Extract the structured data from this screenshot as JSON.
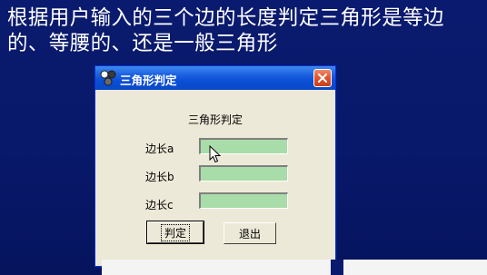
{
  "slide": {
    "line1": "根据用户输入的三个边的长度判定三角形是等边",
    "line2": "的、等腰的、还是一般三角形"
  },
  "window": {
    "title": "三角形判定",
    "icon": "triangle-app-icon",
    "close_icon": "close-icon",
    "heading": "三角形判定",
    "fields": [
      {
        "label": "边长a",
        "value": ""
      },
      {
        "label": "边长b",
        "value": ""
      },
      {
        "label": "边长c",
        "value": ""
      }
    ],
    "buttons": {
      "judge": "判定",
      "exit": "退出"
    }
  },
  "colors": {
    "slide_background": "#0a1a6e",
    "titlebar": "#0b4fd6",
    "input_fill": "#a8dca8",
    "close_button": "#e0522a"
  }
}
